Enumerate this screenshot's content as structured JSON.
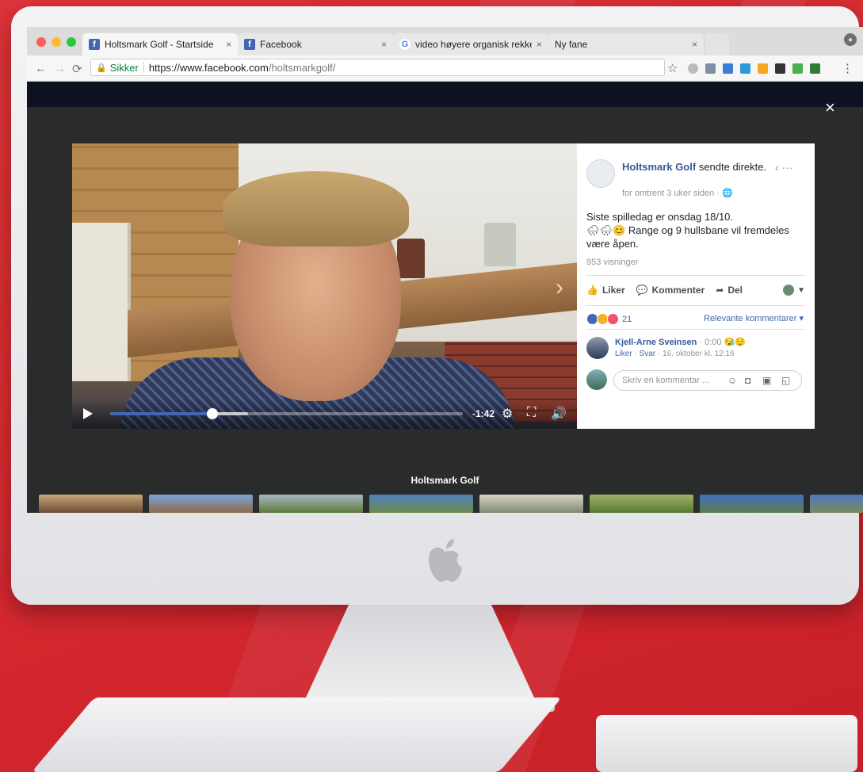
{
  "browser": {
    "tabs": [
      {
        "title": "Holtsmark Golf - Startside",
        "icon": "facebook-icon",
        "active": true
      },
      {
        "title": "Facebook",
        "icon": "facebook-icon",
        "active": false
      },
      {
        "title": "video høyere organisk rekkevid",
        "icon": "google-icon",
        "active": false
      },
      {
        "title": "Ny fane",
        "icon": "",
        "active": false
      }
    ],
    "tab_close": "×",
    "secure_label": "Sikker",
    "url_host": "https://www.facebook.com",
    "url_path": "/holtsmarkgolf/"
  },
  "viewer": {
    "close_label": "×",
    "video": {
      "time_remaining": "-1:42",
      "progress": 0.29,
      "buffered": 0.39
    },
    "post": {
      "author": "Holtsmark Golf",
      "author_action": "sendte direkte.",
      "timestamp": "for omtrent 3 uker siden",
      "text_line1": "Siste spilledag er onsdag 18/10.",
      "text_line2": "Range og 9 hullsbane vil fremdeles",
      "text_line3": "være åpen.",
      "views": "953 visninger",
      "actions": {
        "like": "Liker",
        "comment": "Kommenter",
        "share": "Del"
      },
      "reaction_count": "21",
      "sort_label": "Relevante kommentarer"
    },
    "comment": {
      "author": "Kjell-Arne Sveinsen",
      "meta": "· 0:00",
      "like": "Liker",
      "reply": "Svar",
      "date": "16. oktober kl. 12:16"
    },
    "comment_input": {
      "placeholder": "Skriv en kommentar ..."
    },
    "strip_title": "Holtsmark Golf"
  },
  "colors": {
    "facebook_blue": "#4267b2",
    "link_blue": "#365899",
    "background_red": "#d82a31"
  }
}
